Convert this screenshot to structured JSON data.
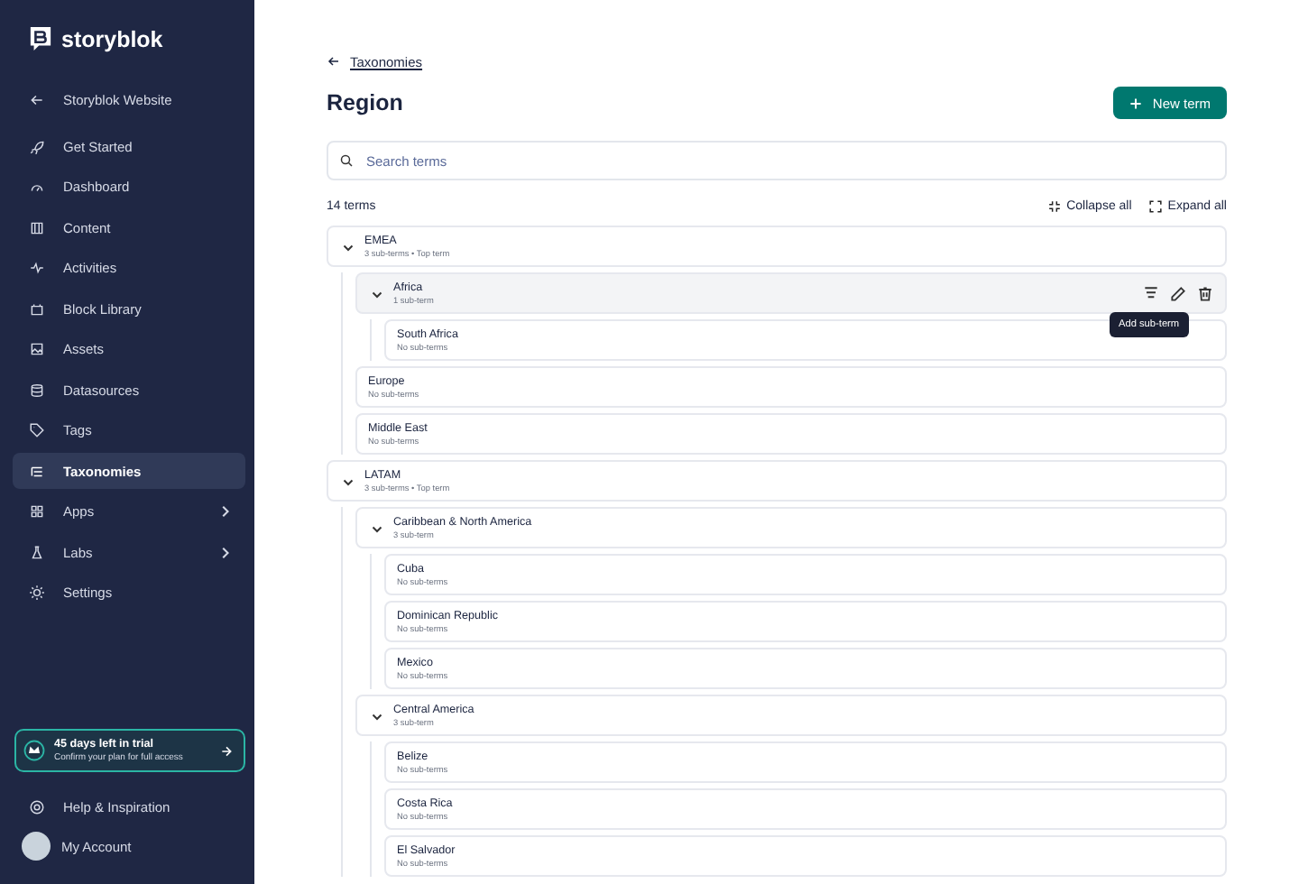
{
  "brand": {
    "name": "storyblok"
  },
  "sidebar": {
    "back_item": {
      "label": "Storyblok Website"
    },
    "items": [
      {
        "label": "Get Started",
        "selected": false,
        "has_submenu": false
      },
      {
        "label": "Dashboard",
        "selected": false,
        "has_submenu": false
      },
      {
        "label": "Content",
        "selected": false,
        "has_submenu": false
      },
      {
        "label": "Activities",
        "selected": false,
        "has_submenu": false
      },
      {
        "label": "Block Library",
        "selected": false,
        "has_submenu": false
      },
      {
        "label": "Assets",
        "selected": false,
        "has_submenu": false
      },
      {
        "label": "Datasources",
        "selected": false,
        "has_submenu": false
      },
      {
        "label": "Tags",
        "selected": false,
        "has_submenu": false
      },
      {
        "label": "Taxonomies",
        "selected": true,
        "has_submenu": false
      },
      {
        "label": "Apps",
        "selected": false,
        "has_submenu": true
      },
      {
        "label": "Labs",
        "selected": false,
        "has_submenu": true
      },
      {
        "label": "Settings",
        "selected": false,
        "has_submenu": false
      }
    ],
    "trial": {
      "title": "45 days left in trial",
      "subtitle": "Confirm your plan for full access"
    },
    "help": {
      "label": "Help & Inspiration"
    },
    "account": {
      "label": "My Account"
    }
  },
  "breadcrumb": {
    "label": "Taxonomies"
  },
  "title": "Region",
  "new_button": {
    "label": "New term"
  },
  "search": {
    "placeholder": "Search terms"
  },
  "count": "14 terms",
  "collapse_all": "Collapse all",
  "expand_all": "Expand all",
  "terms": [
    {
      "name": "EMEA",
      "meta": "3 sub-terms • Top term",
      "expanded": true,
      "hovered": false,
      "children": [
        {
          "name": "Africa",
          "meta": "1 sub-term",
          "expanded": true,
          "hovered": true,
          "tooltip": "Add sub-term",
          "children": [
            {
              "name": "South Africa",
              "meta": "No sub-terms",
              "hovered": false
            }
          ]
        },
        {
          "name": "Europe",
          "meta": "No sub-terms",
          "hovered": false
        },
        {
          "name": "Middle East",
          "meta": "No sub-terms",
          "hovered": false
        }
      ]
    },
    {
      "name": "LATAM",
      "meta": "3 sub-terms • Top term",
      "expanded": true,
      "hovered": false,
      "children": [
        {
          "name": "Caribbean & North America",
          "meta": "3 sub-term",
          "expanded": true,
          "hovered": false,
          "children": [
            {
              "name": "Cuba",
              "meta": "No sub-terms",
              "hovered": false
            },
            {
              "name": "Dominican Republic",
              "meta": "No sub-terms",
              "hovered": false
            },
            {
              "name": "Mexico",
              "meta": "No sub-terms",
              "hovered": false
            }
          ]
        },
        {
          "name": "Central America",
          "meta": "3 sub-term",
          "expanded": true,
          "hovered": false,
          "children": [
            {
              "name": "Belize",
              "meta": "No sub-terms",
              "hovered": false
            },
            {
              "name": "Costa Rica",
              "meta": "No sub-terms",
              "hovered": false
            },
            {
              "name": "El Salvador",
              "meta": "No sub-terms",
              "hovered": false
            }
          ]
        }
      ]
    }
  ]
}
